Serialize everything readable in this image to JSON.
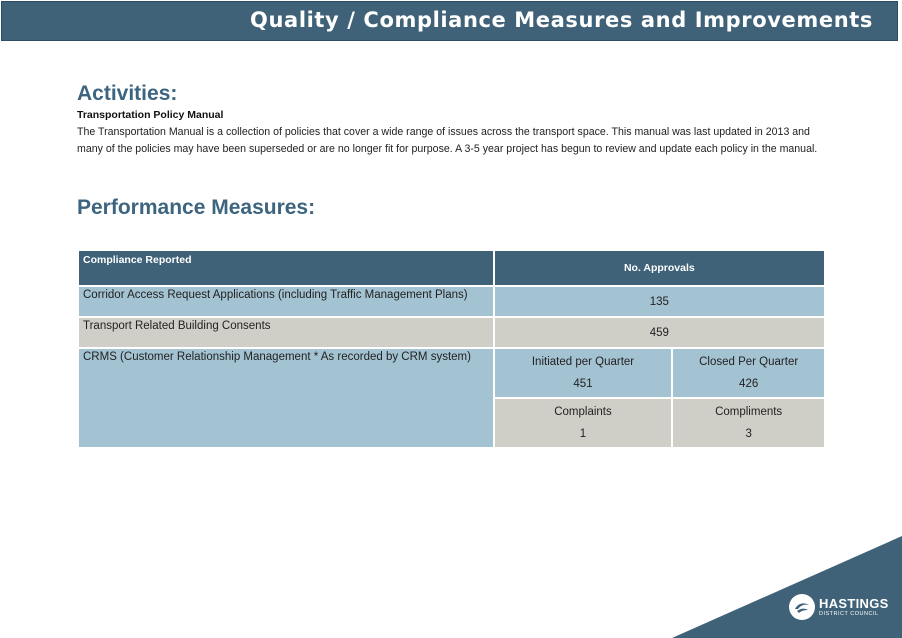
{
  "header": {
    "title": "Quality / Compliance Measures and Improvements"
  },
  "activities": {
    "heading": "Activities:",
    "subheading": "Transportation Policy Manual",
    "paragraph": "The Transportation Manual is a collection of policies that cover a wide range of issues across the transport space. This manual was last updated in 2013 and many of the policies may have been superseded or are no longer fit for purpose. A 3-5 year project has begun to review and update each policy in the manual."
  },
  "performance": {
    "heading": "Performance Measures:",
    "table": {
      "headers": [
        "Compliance Reported",
        "No. Approvals"
      ],
      "rows": [
        {
          "label": "Corridor Access Request Applications (including Traffic Management Plans)",
          "value": "135"
        },
        {
          "label": "Transport Related Building Consents",
          "value": "459"
        }
      ],
      "crms": {
        "label": "CRMS (Customer Relationship Management * As recorded by CRM system)",
        "initiated_label": "Initiated per Quarter",
        "initiated_value": "451",
        "closed_label": "Closed Per Quarter",
        "closed_value": "426",
        "complaints_label": "Complaints",
        "complaints_value": "1",
        "compliments_label": "Compliments",
        "compliments_value": "3"
      }
    }
  },
  "logo": {
    "name": "HASTINGS",
    "sub": "DISTRICT COUNCIL",
    "icon": "hastings-logo-icon"
  },
  "colors": {
    "brand": "#3f6279",
    "blue_cell": "#a4c3d2",
    "grey_cell": "#d0cfc7",
    "heading": "#3d6580"
  }
}
